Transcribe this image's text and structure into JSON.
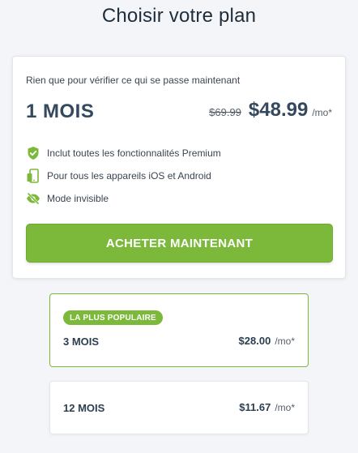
{
  "page": {
    "title": "Choisir votre plan"
  },
  "main_plan": {
    "subtitle": "Rien que pour vérifier ce qui se passe maintenant",
    "name": "1 MOIS",
    "old_price": "$69.99",
    "new_price": "$48.99",
    "per": "/mo*",
    "features": [
      {
        "icon": "check-shield-icon",
        "label": "Inclut toutes les fonctionnalités Premium"
      },
      {
        "icon": "devices-icon",
        "label": "Pour tous les appareils iOS et Android"
      },
      {
        "icon": "eye-off-icon",
        "label": "Mode invisible"
      }
    ],
    "buy_label": "ACHETER MAINTENANT"
  },
  "options": [
    {
      "badge": "LA PLUS POPULAIRE",
      "name": "3 MOIS",
      "price": "$28.00",
      "per": "/mo*"
    },
    {
      "name": "12 MOIS",
      "price": "$11.67",
      "per": "/mo*"
    }
  ],
  "colors": {
    "accent": "#7cb83a",
    "text": "#34495e",
    "background": "#f4f5f8"
  }
}
